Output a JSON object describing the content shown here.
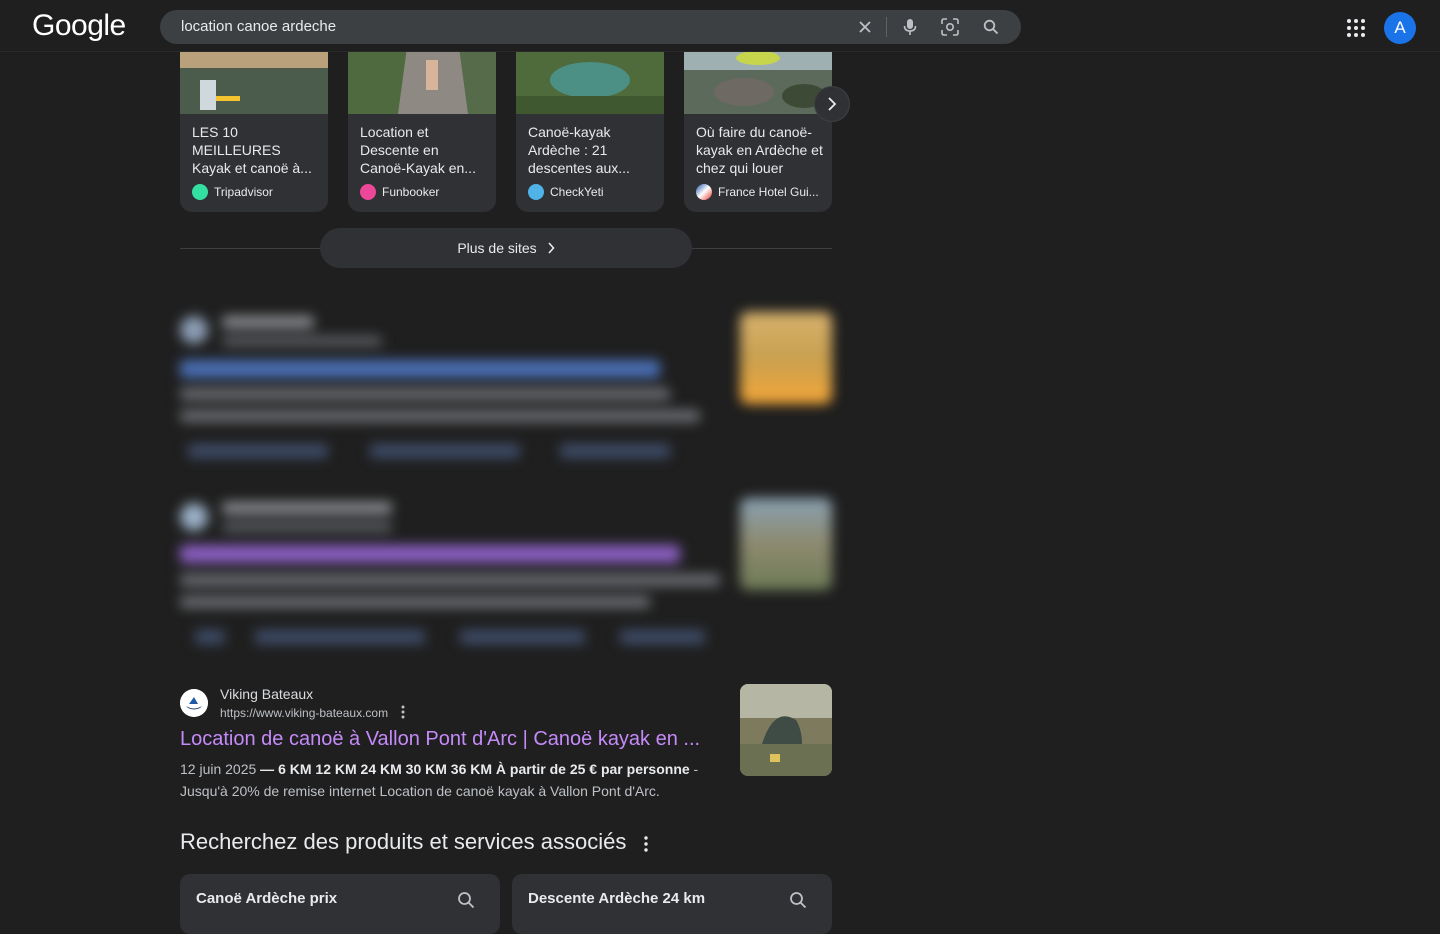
{
  "header": {
    "logo": "Google",
    "search_query": "location canoe ardeche",
    "avatar_letter": "A"
  },
  "sites": [
    {
      "title": "LES 10 MEILLEURES Kayak et canoë à...",
      "source": "Tripadvisor",
      "fav_color": "#34e0a1"
    },
    {
      "title": "Location et Descente en Canoë-Kayak en...",
      "source": "Funbooker",
      "fav_color": "#ec4899"
    },
    {
      "title": "Canoë-kayak Ardèche : 21 descentes aux...",
      "source": "CheckYeti",
      "fav_color": "#4fb3e8"
    },
    {
      "title": "Où faire du canoë-kayak en Ardèche et chez qui louer",
      "source": "France Hotel Gui...",
      "fav_color": "#e53935"
    }
  ],
  "more_sites_label": "Plus de sites",
  "result": {
    "site_name": "Viking Bateaux",
    "url": "https://www.viking-bateaux.com",
    "title": "Location de canoë à Vallon Pont d'Arc | Canoë kayak en ...",
    "date": "12 juin 2025",
    "snippet_plain": " — 6 KM 12 KM 24 KM 30 KM 36 KM ",
    "snippet_bold": "À partir de 25 € par personne",
    "snippet_line2": " - Jusqu'à 20% de remise internet Location de canoë kayak à Vallon Pont d'Arc."
  },
  "related": {
    "heading": "Recherchez des produits et services associés",
    "items": [
      "Canoë Ardèche prix",
      "Descente Ardèche 24 km"
    ]
  },
  "colors": {
    "background": "#1f1f1f",
    "surface": "#303134",
    "visited_link": "#c58af9",
    "avatar": "#1a73e8"
  }
}
